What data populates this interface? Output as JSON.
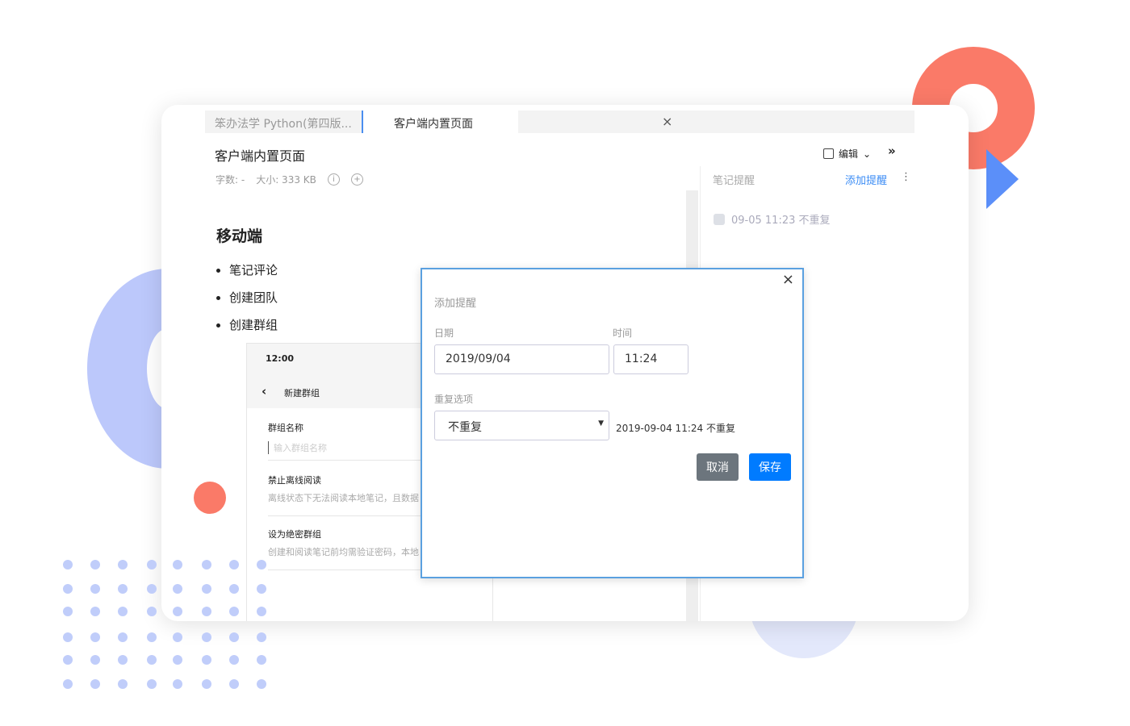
{
  "tabs": [
    {
      "label": "笨办法学 Python(第四版..."
    },
    {
      "label": "客户端内置页面",
      "close": "×"
    }
  ],
  "doc": {
    "title": "客户端内置页面",
    "word_count": "字数: -",
    "size": "大小: 333 KB",
    "heading": "移动端",
    "bullets": [
      "笔记评论",
      "创建团队",
      "创建群组"
    ]
  },
  "toolbar": {
    "edit": "编辑",
    "more": "»"
  },
  "reminder_panel": {
    "title": "笔记提醒",
    "add": "添加提醒",
    "menu": "⋮",
    "items": [
      {
        "text": "09-05 11:23 不重复"
      }
    ]
  },
  "phone": {
    "time": "12:00",
    "back": "‹",
    "nav_title": "新建群组",
    "group_name_label": "群组名称",
    "group_name_placeholder": "输入群组名称",
    "offline_title": "禁止离线阅读",
    "offline_desc": "离线状态下无法阅读本地笔记，且数据",
    "secret_title": "设为绝密群组",
    "secret_desc": "创建和阅读笔记前均需验证密码，本地"
  },
  "dialog": {
    "title": "添加提醒",
    "close": "×",
    "date_label": "日期",
    "date_value": "2019/09/04",
    "time_label": "时间",
    "time_value": "11:24",
    "repeat_label": "重复选项",
    "repeat_value": "不重复",
    "summary": "2019-09-04 11:24 不重复",
    "cancel": "取消",
    "save": "保存"
  },
  "colors": {
    "accent": "#007bff",
    "cancel": "#6c757d",
    "coral": "#fa7a68",
    "lavender": "#bcc8fb"
  }
}
